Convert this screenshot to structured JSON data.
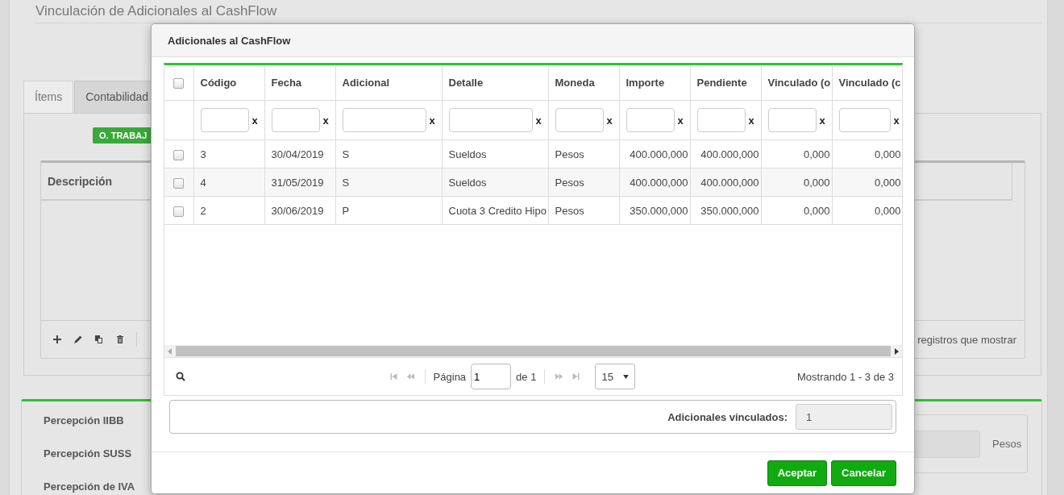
{
  "page": {
    "title": "Vinculación de Adicionales al CashFlow",
    "tabs": [
      {
        "label": "Ítems",
        "selected": true
      },
      {
        "label": "Contabilidad",
        "selected": false
      }
    ],
    "badge": "O. TRABAJ",
    "grid": {
      "column": "Descripción",
      "pager_text": "registros que mostrar"
    },
    "perceptions": [
      "Percepción IIBB",
      "Percepción SUSS",
      "Percepción de IVA"
    ],
    "currency": "Pesos"
  },
  "dialog": {
    "title": "Adicionales al CashFlow",
    "select_all_checked": false,
    "columns": [
      {
        "label": "Código",
        "kind": "text",
        "clear": "x"
      },
      {
        "label": "Fecha",
        "kind": "text",
        "clear": "x"
      },
      {
        "label": "Adicional",
        "kind": "text",
        "clear": "x"
      },
      {
        "label": "Detalle",
        "kind": "text",
        "clear": "x"
      },
      {
        "label": "Moneda",
        "kind": "text",
        "clear": "x"
      },
      {
        "label": "Importe",
        "kind": "number",
        "clear": "x"
      },
      {
        "label": "Pendiente",
        "kind": "number",
        "clear": "x"
      },
      {
        "label": "Vinculado (o",
        "kind": "number",
        "clear": "x"
      },
      {
        "label": "Vinculado (c",
        "kind": "number",
        "clear": "x"
      }
    ],
    "rows": [
      {
        "checked": false,
        "cells": [
          "3",
          "30/04/2019",
          "S",
          "Sueldos",
          "Pesos",
          "400.000,000",
          "400.000,000",
          "0,000",
          "0,000"
        ]
      },
      {
        "checked": false,
        "cells": [
          "4",
          "31/05/2019",
          "S",
          "Sueldos",
          "Pesos",
          "400.000,000",
          "400.000,000",
          "0,000",
          "0,000"
        ]
      },
      {
        "checked": false,
        "cells": [
          "2",
          "30/06/2019",
          "P",
          "Cuota 3 Credito Hipo",
          "Pesos",
          "350.000,000",
          "350.000,000",
          "0,000",
          "0,000"
        ]
      }
    ],
    "pager": {
      "page_label": "Página",
      "page": "1",
      "of": "de 1",
      "page_size": "15",
      "summary": "Mostrando 1 - 3 de 3"
    },
    "linked": {
      "label": "Adicionales vinculados:",
      "value": "1"
    },
    "buttons": [
      "Aceptar",
      "Cancelar"
    ]
  }
}
